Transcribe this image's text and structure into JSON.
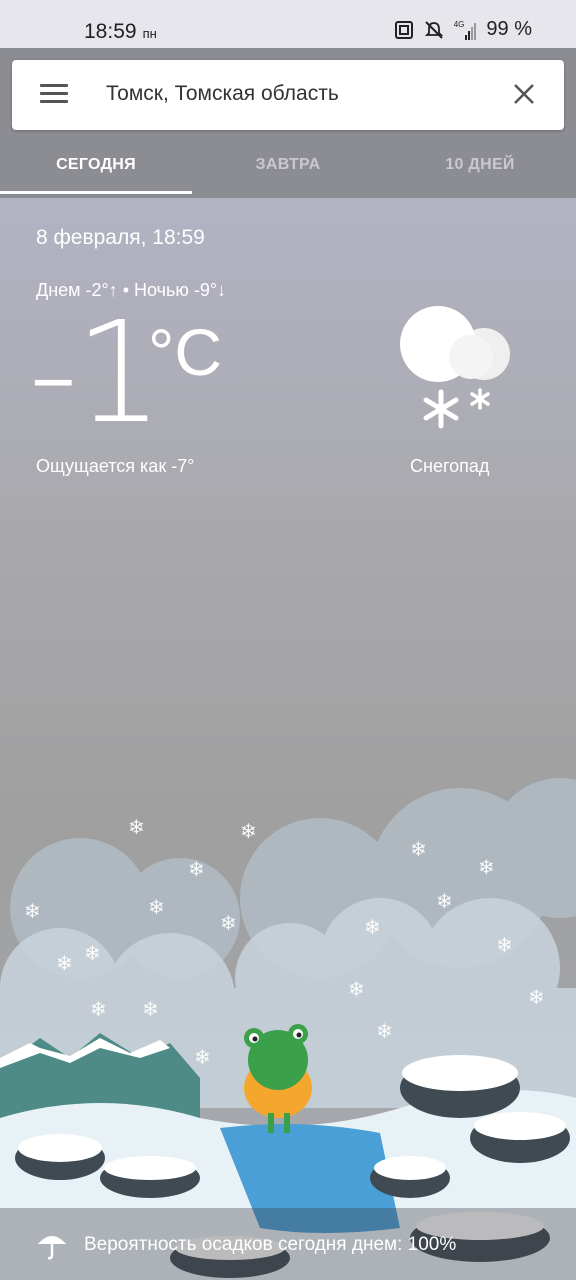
{
  "status_bar": {
    "time": "18:59",
    "day": "пн",
    "network": "4G",
    "battery": "99 %"
  },
  "search": {
    "location": "Томск, Томская область"
  },
  "tabs": [
    {
      "label": "СЕГОДНЯ",
      "active": true
    },
    {
      "label": "ЗАВТРА",
      "active": false
    },
    {
      "label": "10 ДНЕЙ",
      "active": false
    }
  ],
  "weather": {
    "datetime": "8 февраля, 18:59",
    "day_night": "Днем -2°↑ • Ночью -9°↓",
    "temperature": "-1",
    "unit": "°C",
    "feels_like": "Ощущается как -7°",
    "condition": "Снегопад",
    "condition_icon": "snow-cloud-icon"
  },
  "precipitation": {
    "text": "Вероятность осадков сегодня днем: 100%",
    "icon": "umbrella-icon"
  },
  "colors": {
    "header_bg": "#8c8c93",
    "sky_top": "#b2b3c3",
    "water": "#4a9fd6"
  }
}
